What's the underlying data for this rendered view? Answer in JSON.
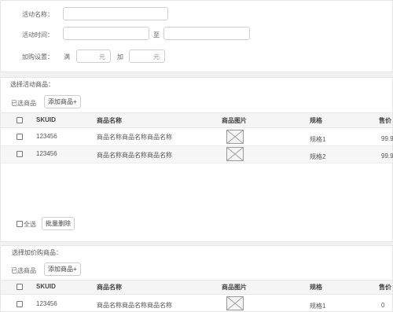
{
  "activity": {
    "name_label": "活动名称：",
    "time_label": "活动时间：",
    "time_separator": "至",
    "addbuy_label": "加购设置：",
    "full_label": "满",
    "add_label": "加",
    "unit_yuan": "元"
  },
  "select_goods": {
    "title": "选择活动商品：",
    "selected_label": "已选商品",
    "add_button": "添加商品+",
    "headers": [
      "SKUID",
      "商品名称",
      "商品图片",
      "规格",
      "售价"
    ],
    "rows": [
      {
        "skuid": "123456",
        "name": "商品名称商品名称商品名称",
        "spec": "规格1",
        "price": "99.9"
      },
      {
        "skuid": "123456",
        "name": "商品名称商品名称商品名称",
        "spec": "规格2",
        "price": "99.9"
      }
    ],
    "select_all": "全选",
    "batch_delete": "批量删除"
  },
  "addbuy_goods": {
    "title": "选择加价购商品：",
    "selected_label": "已选商品",
    "add_button": "添加商品+",
    "headers": [
      "SKUID",
      "商品名称",
      "商品图片",
      "规格",
      "售价"
    ],
    "rows": [
      {
        "skuid": "123456",
        "name": "商品名称商品名称商品名称",
        "spec": "规格1",
        "price": "0"
      }
    ]
  }
}
